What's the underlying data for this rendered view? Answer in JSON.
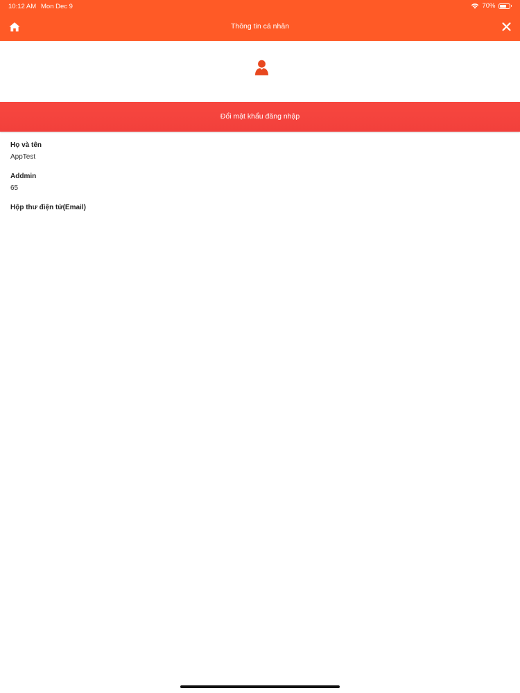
{
  "status_bar": {
    "time": "10:12 AM",
    "date": "Mon Dec 9",
    "battery_text": "70%",
    "battery_level": 0.7
  },
  "nav": {
    "title": "Thông tin cá nhân",
    "home_icon": "home-icon",
    "close_icon": "close-icon"
  },
  "avatar": {
    "icon": "user-icon"
  },
  "actions": {
    "change_password_label": "Đổi mật khẩu đăng nhập"
  },
  "profile": {
    "fields": [
      {
        "label": "Họ và tên",
        "value": "AppTest"
      },
      {
        "label": "Addmin",
        "value": "65"
      },
      {
        "label": "Hộp thư điện tử(Email)",
        "value": ""
      }
    ]
  },
  "colors": {
    "header": "#ff5a26",
    "button": "#f4443d",
    "avatar_icon": "#e8481f"
  }
}
